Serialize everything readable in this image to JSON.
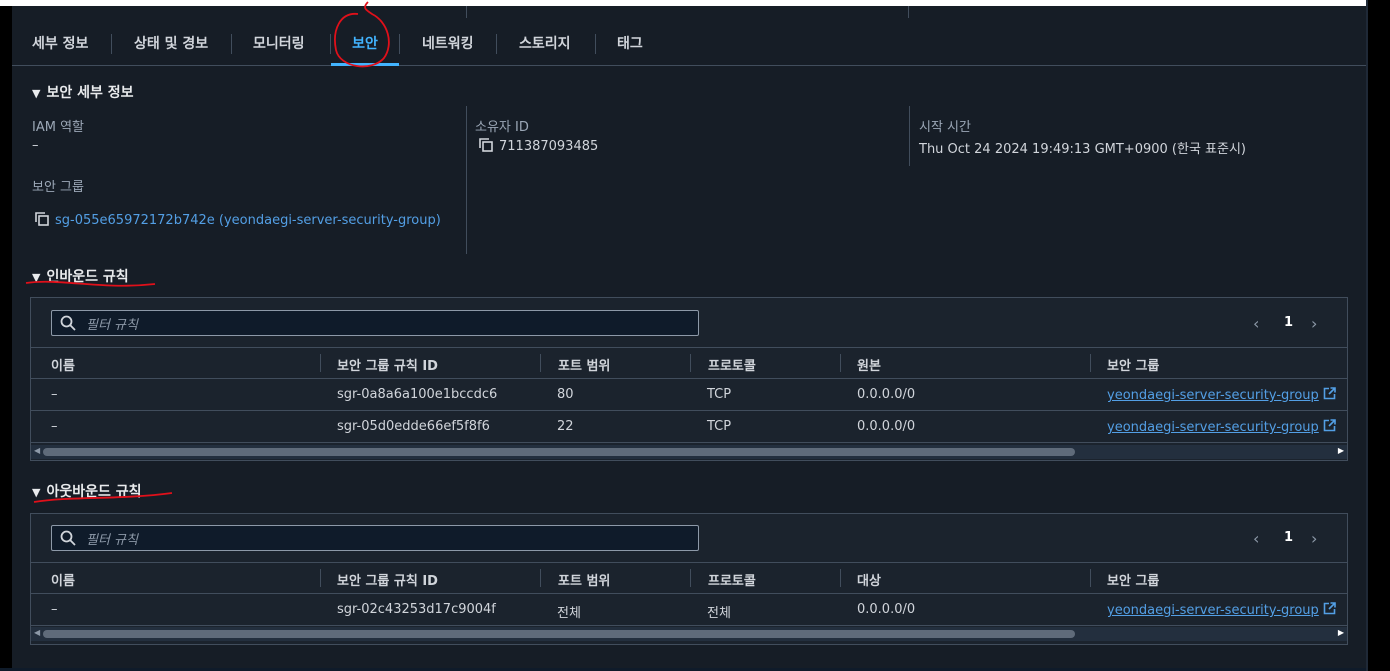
{
  "tabs": [
    {
      "label": "세부 정보"
    },
    {
      "label": "상태 및 경보"
    },
    {
      "label": "모니터링"
    },
    {
      "label": "보안"
    },
    {
      "label": "네트워킹"
    },
    {
      "label": "스토리지"
    },
    {
      "label": "태그"
    }
  ],
  "active_tab": "보안",
  "security_details": {
    "header": "보안 세부 정보",
    "iam_role_label": "IAM 역할",
    "iam_role_value": "–",
    "owner_id_label": "소유자 ID",
    "owner_id_value": "711387093485",
    "launch_time_label": "시작 시간",
    "launch_time_value": "Thu Oct 24 2024 19:49:13 GMT+0900 (한국 표준시)",
    "security_groups_label": "보안 그룹",
    "security_group_link": "sg-055e65972172b742e (yeondaegi-server-security-group)"
  },
  "inbound": {
    "header": "인바운드 규칙",
    "search_placeholder": "필터 규칙",
    "page": "1",
    "columns": [
      "이름",
      "보안 그룹 규칙 ID",
      "포트 범위",
      "프로토콜",
      "원본",
      "보안 그룹"
    ],
    "rows": [
      {
        "name": "–",
        "rule_id": "sgr-0a8a6a100e1bccdc6",
        "port": "80",
        "protocol": "TCP",
        "source": "0.0.0.0/0",
        "sg": "yeondaegi-server-security-group"
      },
      {
        "name": "–",
        "rule_id": "sgr-05d0edde66ef5f8f6",
        "port": "22",
        "protocol": "TCP",
        "source": "0.0.0.0/0",
        "sg": "yeondaegi-server-security-group"
      }
    ]
  },
  "outbound": {
    "header": "아웃바운드 규칙",
    "search_placeholder": "필터 규칙",
    "page": "1",
    "columns": [
      "이름",
      "보안 그룹 규칙 ID",
      "포트 범위",
      "프로토콜",
      "대상",
      "보안 그룹"
    ],
    "rows": [
      {
        "name": "–",
        "rule_id": "sgr-02c43253d17c9004f",
        "port": "전체",
        "protocol": "전체",
        "source": "0.0.0.0/0",
        "sg": "yeondaegi-server-security-group"
      }
    ]
  },
  "colors": {
    "accent": "#42b4ff",
    "link": "#539fe5",
    "annotation": "#e0101a"
  }
}
